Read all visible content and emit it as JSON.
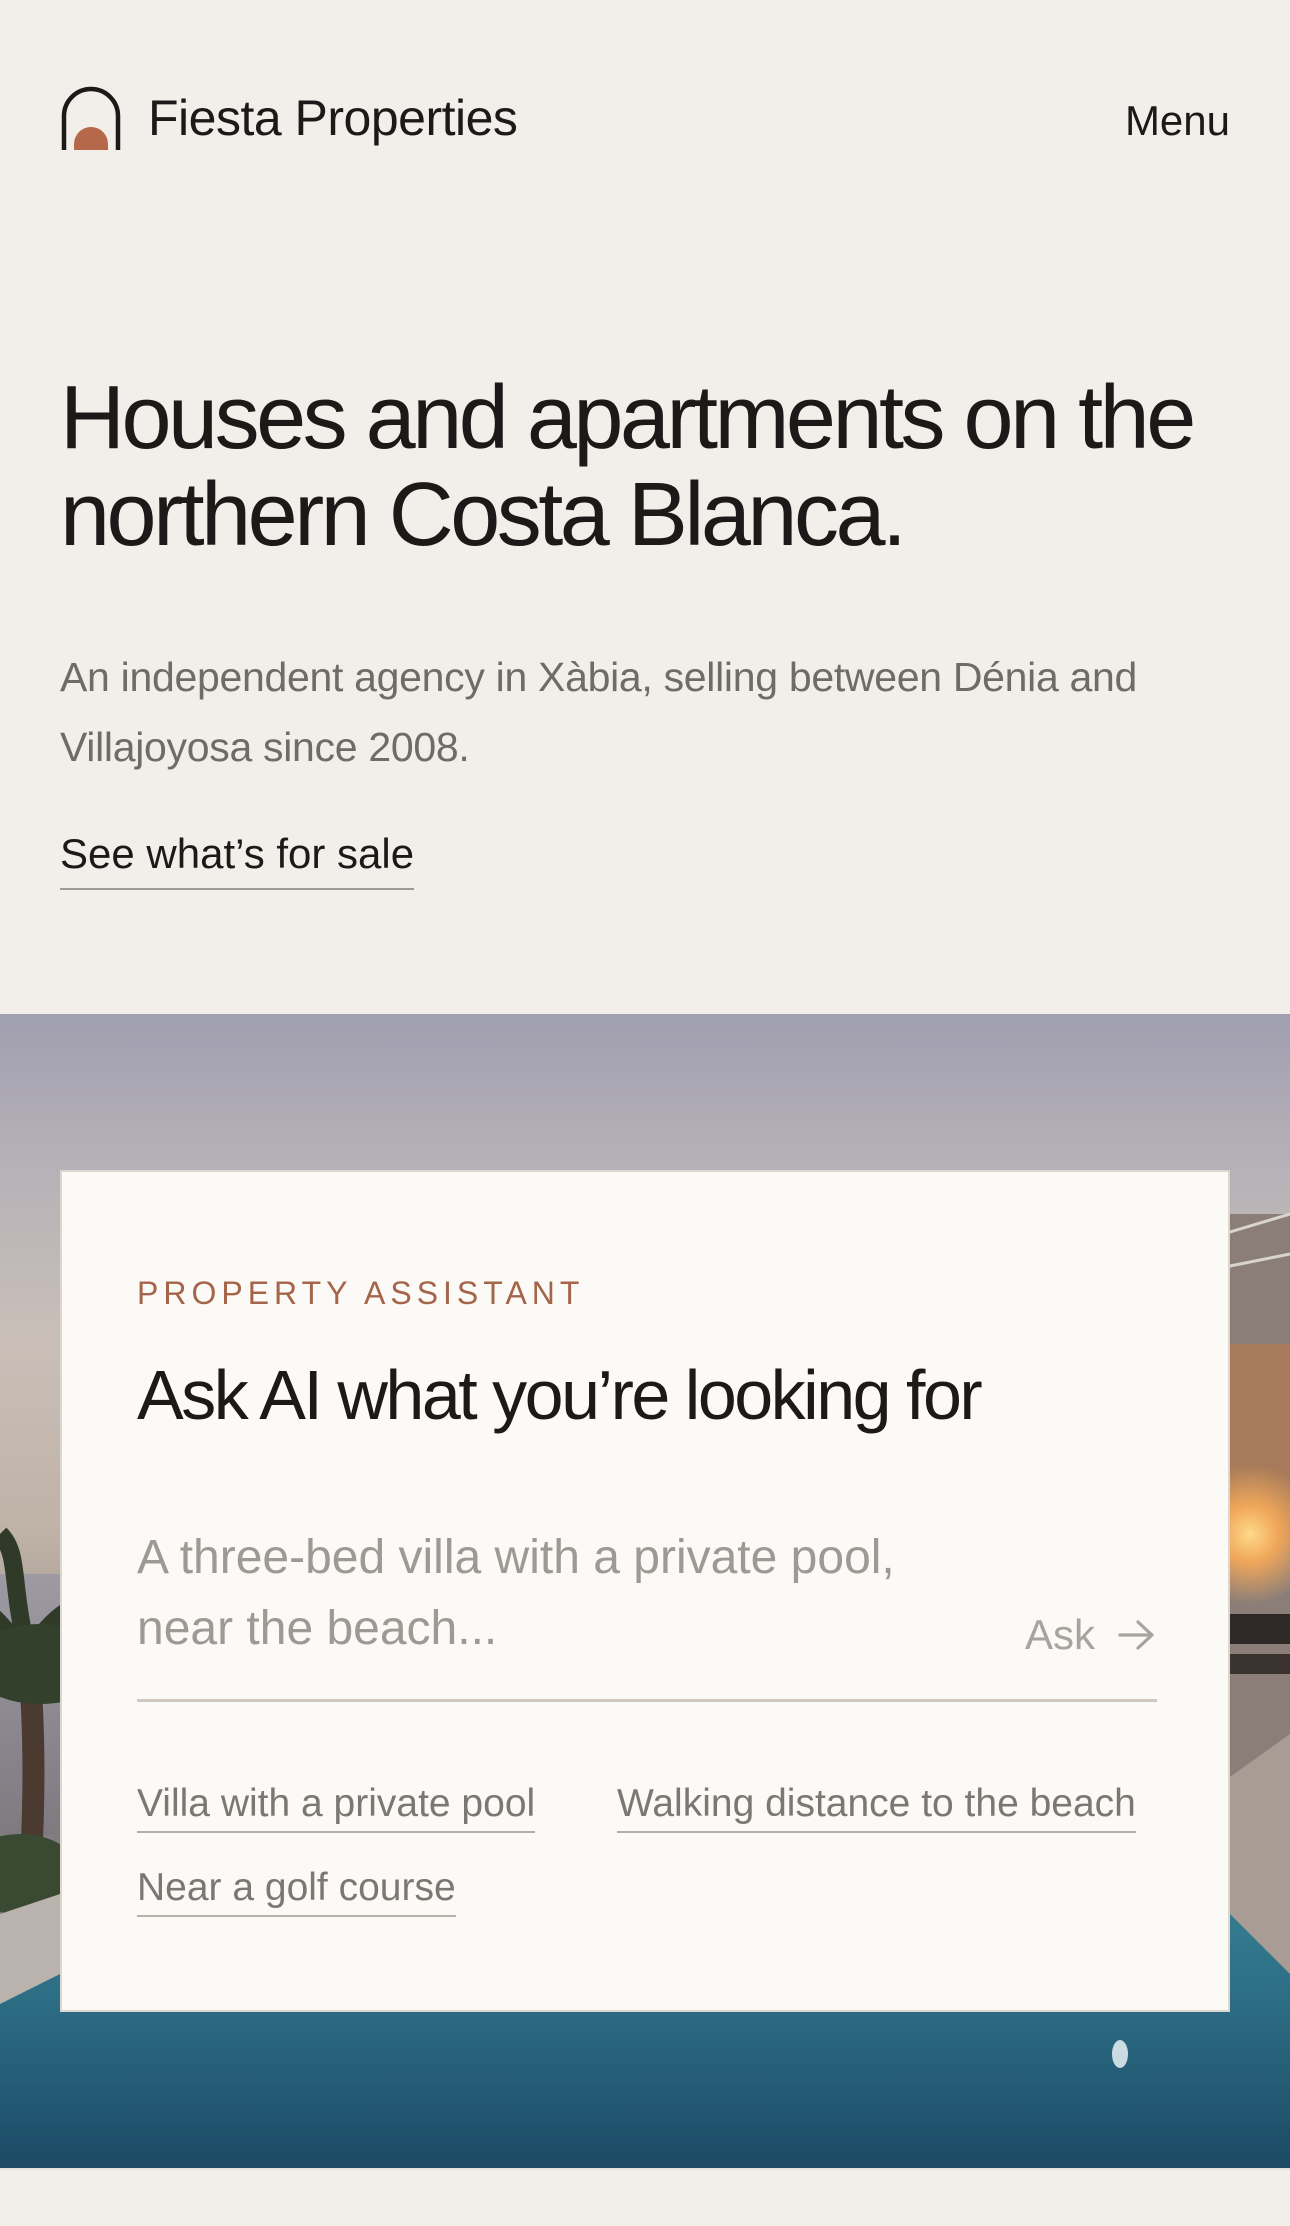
{
  "header": {
    "brand_name": "Fiesta Properties",
    "logo_icon": "arch-icon",
    "menu_label": "Menu"
  },
  "hero": {
    "title": "Houses and apartments on the northern Costa Blanca.",
    "subtitle": "An independent agency in Xàbia, selling between Dénia and Villajoyosa since 2008.",
    "cta_label": "See what’s for sale"
  },
  "assistant": {
    "eyebrow": "PROPERTY ASSISTANT",
    "title": "Ask AI what you’re looking for",
    "input_placeholder": "A three-bed villa with a private pool, near the beach...",
    "input_value": "",
    "ask_label": "Ask",
    "ask_icon": "arrow-right-icon",
    "suggestions": [
      "Villa with a private pool",
      "Walking distance to the beach",
      "Near a golf course"
    ]
  },
  "colors": {
    "background": "#f2efea",
    "accent": "#a5654a",
    "text": "#1b1a19",
    "muted": "#6f6b67",
    "card": "#fcfaf6"
  }
}
